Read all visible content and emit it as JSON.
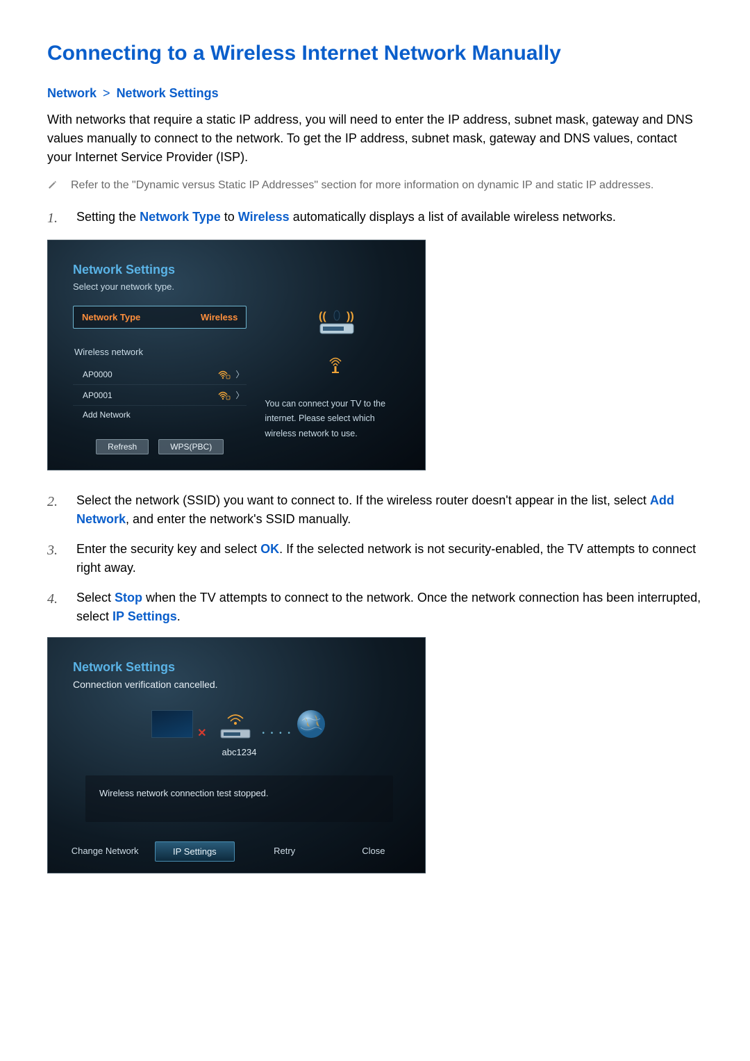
{
  "title": "Connecting to a Wireless Internet Network Manually",
  "breadcrumb": {
    "a": "Network",
    "b": "Network Settings"
  },
  "intro": "With networks that require a static IP address, you will need to enter the IP address, subnet mask, gateway and DNS values manually to connect to the network. To get the IP address, subnet mask, gateway and DNS values, contact your Internet Service Provider (ISP).",
  "note": "Refer to the \"Dynamic versus Static IP Addresses\" section for more information on dynamic IP and static IP addresses.",
  "steps": {
    "s1_a": "Setting the ",
    "s1_kw1": "Network Type",
    "s1_b": " to ",
    "s1_kw2": "Wireless",
    "s1_c": " automatically displays a list of available wireless networks.",
    "s2_a": "Select the network (SSID) you want to connect to. If the wireless router doesn't appear in the list, select ",
    "s2_kw": "Add Network",
    "s2_b": ", and enter the network's SSID manually.",
    "s3_a": "Enter the security key and select ",
    "s3_kw": "OK",
    "s3_b": ". If the selected network is not security-enabled, the TV attempts to connect right away.",
    "s4_a": "Select ",
    "s4_kw1": "Stop",
    "s4_b": " when the TV attempts to connect to the network. Once the network connection has been interrupted, select ",
    "s4_kw2": "IP Settings",
    "s4_c": "."
  },
  "panel1": {
    "title": "Network Settings",
    "subtitle": "Select your network type.",
    "row_label": "Network Type",
    "row_value": "Wireless",
    "section": "Wireless network",
    "items": [
      "AP0000",
      "AP0001",
      "Add Network"
    ],
    "btn_refresh": "Refresh",
    "btn_wps": "WPS(PBC)",
    "right_text_1": "You can connect your TV to the",
    "right_text_2": "internet. Please select which",
    "right_text_3": "wireless network to use."
  },
  "panel2": {
    "title": "Network Settings",
    "status": "Connection verification cancelled.",
    "ssid": "abc1234",
    "msg": "Wireless network connection test stopped.",
    "btns": [
      "Change Network",
      "IP Settings",
      "Retry",
      "Close"
    ]
  }
}
